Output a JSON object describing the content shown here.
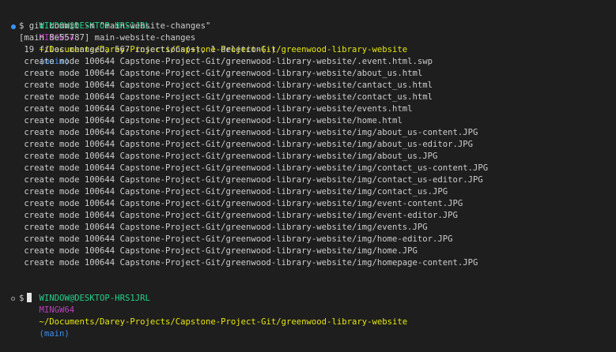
{
  "prompt": {
    "user_host": "WINDOW@DESKTOP-HRS1JRL",
    "shell": "MINGW64",
    "path": "~/Documents/Darey-Projects/Capstone-Project-Git/greenwood-library-website",
    "branch": "(main)",
    "symbol": "$"
  },
  "command": "git commit -m \"main-website-changes\"",
  "output": {
    "commit_header": "[main 8e55787] main-website-changes",
    "summary": " 19 files changed, 567 insertions(+), 1 deletion(-)",
    "created_files": [
      " create mode 100644 Capstone-Project-Git/greenwood-library-website/.event.html.swp",
      " create mode 100644 Capstone-Project-Git/greenwood-library-website/about_us.html",
      " create mode 100644 Capstone-Project-Git/greenwood-library-website/cantact_us.html",
      " create mode 100644 Capstone-Project-Git/greenwood-library-website/contact_us.html",
      " create mode 100644 Capstone-Project-Git/greenwood-library-website/events.html",
      " create mode 100644 Capstone-Project-Git/greenwood-library-website/home.html",
      " create mode 100644 Capstone-Project-Git/greenwood-library-website/img/about_us-content.JPG",
      " create mode 100644 Capstone-Project-Git/greenwood-library-website/img/about_us-editor.JPG",
      " create mode 100644 Capstone-Project-Git/greenwood-library-website/img/about_us.JPG",
      " create mode 100644 Capstone-Project-Git/greenwood-library-website/img/contact_us-content.JPG",
      " create mode 100644 Capstone-Project-Git/greenwood-library-website/img/contact_us-editor.JPG",
      " create mode 100644 Capstone-Project-Git/greenwood-library-website/img/contact_us.JPG",
      " create mode 100644 Capstone-Project-Git/greenwood-library-website/img/event-content.JPG",
      " create mode 100644 Capstone-Project-Git/greenwood-library-website/img/event-editor.JPG",
      " create mode 100644 Capstone-Project-Git/greenwood-library-website/img/events.JPG",
      " create mode 100644 Capstone-Project-Git/greenwood-library-website/img/home-editor.JPG",
      " create mode 100644 Capstone-Project-Git/greenwood-library-website/img/home.JPG",
      " create mode 100644 Capstone-Project-Git/greenwood-library-website/img/homepage-content.JPG"
    ]
  },
  "colors": {
    "background": "#1e1e1e",
    "text": "#cccccc",
    "user_host": "#23d18b",
    "shell": "#bc3fbc",
    "path": "#e5e510",
    "branch": "#3b8eea",
    "decoration_success": "#3794ff"
  }
}
